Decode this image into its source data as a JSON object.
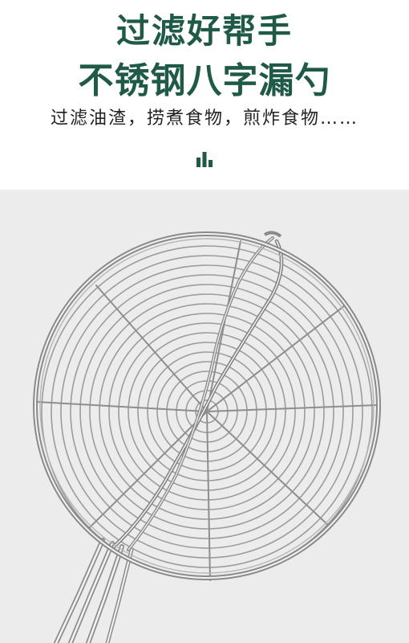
{
  "header": {
    "title_line1": "过滤好帮手",
    "title_line2": "不锈钢八字漏勺",
    "subtitle": "过滤油渣，捞煮食物，煎炸食物……",
    "accent_color": "#1e5a47",
    "icon": "bar-chart-icon"
  },
  "photo": {
    "subject": "stainless steel wire strainer",
    "background": "#ececec"
  }
}
